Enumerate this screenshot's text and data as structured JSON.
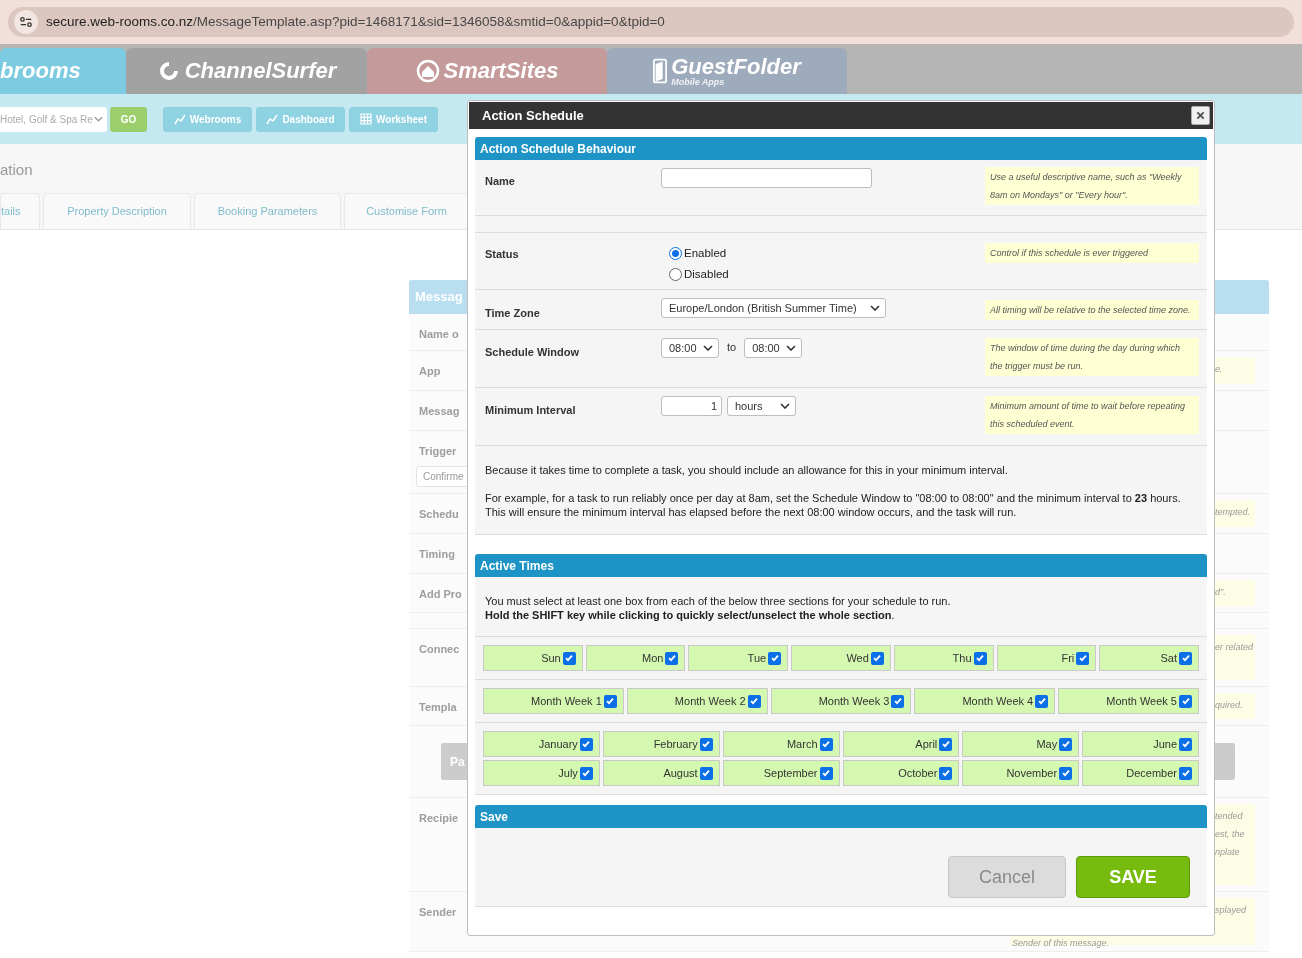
{
  "browser": {
    "url_host": "secure.web-rooms.co.nz",
    "url_path": "/MessageTemplate.asp?pid=1468171&sid=1346058&smtid=0&appid=0&tpid=0"
  },
  "brand_tabs": [
    {
      "kind": "webrooms",
      "label": "brooms",
      "color": "#7ccbe0"
    },
    {
      "kind": "swirl",
      "label": "ChannelSurfer",
      "color": "#a2a2a2"
    },
    {
      "kind": "house",
      "label": "SmartSites",
      "color": "#c49a9a"
    },
    {
      "kind": "phone",
      "label": "GuestFolder",
      "sublabel": "Mobile Apps",
      "color": "#9eabbd"
    }
  ],
  "toolbar": {
    "property_select": "Hotel, Golf & Spa Re",
    "go": "GO",
    "buttons": [
      {
        "kind": "chart",
        "label": "Webrooms"
      },
      {
        "kind": "chart",
        "label": "Dashboard"
      },
      {
        "kind": "grid",
        "label": "Worksheet"
      }
    ]
  },
  "page": {
    "title": "ation",
    "tabs": [
      {
        "label": "tails"
      },
      {
        "label": "Property Description"
      },
      {
        "label": "Booking Parameters"
      },
      {
        "label": "Customise Form"
      }
    ]
  },
  "panel": {
    "header": "Messag",
    "rows": [
      {
        "kind": "field",
        "label": "Name o"
      },
      {
        "kind": "field",
        "label": "App",
        "hint": [
          "e."
        ]
      },
      {
        "kind": "field",
        "label": "Messag"
      },
      {
        "kind": "input",
        "label": "Trigger",
        "value": "Confirme"
      },
      {
        "kind": "field",
        "label": "Schedu",
        "hint": [
          "tempted."
        ]
      },
      {
        "kind": "field",
        "label": "Timing"
      },
      {
        "kind": "field",
        "label": "Add Pro",
        "hint": [
          "d\"."
        ]
      },
      {
        "kind": "spacer"
      },
      {
        "kind": "field",
        "label": "Connec",
        "hint": [
          "er related"
        ]
      },
      {
        "kind": "field",
        "label": "Templa",
        "hint": [
          "quired."
        ]
      },
      {
        "kind": "button",
        "label": "Pa"
      },
      {
        "kind": "field",
        "label": "Recipie",
        "hint": [
          "tended",
          "est, the",
          "nplate"
        ]
      },
      {
        "kind": "field",
        "label": "Sender",
        "hint": [
          "splayed"
        ],
        "hint_below": "Sender of this message."
      }
    ]
  },
  "modal": {
    "title": "Action Schedule",
    "behaviour": {
      "header": "Action Schedule Behaviour",
      "name": {
        "label": "Name",
        "hint": "Use a useful descriptive name, such as \"Weekly 8am on Mondays\" or \"Every hour\"."
      },
      "status": {
        "label": "Status",
        "options": [
          {
            "label": "Enabled",
            "selected": true
          },
          {
            "label": "Disabled",
            "selected": false
          }
        ],
        "hint": "Control if this schedule is ever triggered"
      },
      "time_zone": {
        "label": "Time Zone",
        "value": "Europe/London (British Summer Time)",
        "hint": "All timing will be relative to the selected time zone."
      },
      "schedule_window": {
        "label": "Schedule Window",
        "from": "08:00",
        "separator": "to",
        "to": "08:00",
        "hint": "The window of time during the day during which the trigger must be run."
      },
      "minimum_interval": {
        "label": "Minimum Interval",
        "value": "1",
        "unit": "hours",
        "hint": "Minimum amount of time to wait before repeating this scheduled event."
      },
      "notes": [
        [
          "Because it takes time to complete a task, you should include an allowance for this in your minimum interval."
        ],
        [
          "For example, for a task to run reliably once per day at 8am, set the Schedule Window to \"08:00 to 08:00\" and the minimum interval to **23** hours.",
          "This will ensure the minimum interval has elapsed before the next 08:00 window occurs, and the task will run."
        ]
      ]
    },
    "active_times": {
      "header": "Active Times",
      "instructions": [
        "You must select at least one box from each of the below three sections for your schedule to run.",
        "**Hold the SHIFT key while clicking to quickly select/unselect the whole section**."
      ],
      "days": [
        {
          "label": "Sun",
          "checked": true
        },
        {
          "label": "Mon",
          "checked": true
        },
        {
          "label": "Tue",
          "checked": true
        },
        {
          "label": "Wed",
          "checked": true
        },
        {
          "label": "Thu",
          "checked": true
        },
        {
          "label": "Fri",
          "checked": true
        },
        {
          "label": "Sat",
          "checked": true
        }
      ],
      "weeks": [
        {
          "label": "Month Week 1",
          "checked": true
        },
        {
          "label": "Month Week 2",
          "checked": true
        },
        {
          "label": "Month Week 3",
          "checked": true
        },
        {
          "label": "Month Week 4",
          "checked": true
        },
        {
          "label": "Month Week 5",
          "checked": true
        }
      ],
      "months": [
        {
          "label": "January",
          "checked": true
        },
        {
          "label": "February",
          "checked": true
        },
        {
          "label": "March",
          "checked": true
        },
        {
          "label": "April",
          "checked": true
        },
        {
          "label": "May",
          "checked": true
        },
        {
          "label": "June",
          "checked": true
        },
        {
          "label": "July",
          "checked": true
        },
        {
          "label": "August",
          "checked": true
        },
        {
          "label": "September",
          "checked": true
        },
        {
          "label": "October",
          "checked": true
        },
        {
          "label": "November",
          "checked": true
        },
        {
          "label": "December",
          "checked": true
        }
      ]
    },
    "save": {
      "header": "Save",
      "cancel": {
        "label": "Cancel",
        "disabled": true
      },
      "save": {
        "label": "SAVE",
        "disabled": false
      }
    }
  }
}
